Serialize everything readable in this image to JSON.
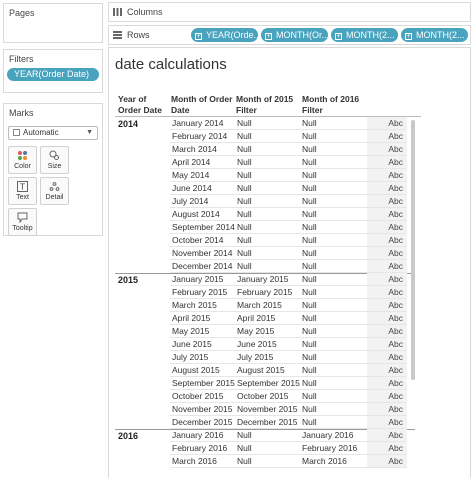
{
  "pages": {
    "title": "Pages"
  },
  "filters": {
    "title": "Filters",
    "items": [
      "YEAR(Order Date)"
    ]
  },
  "marks": {
    "title": "Marks",
    "type": "Automatic",
    "buttons": [
      "Color",
      "Size",
      "Text",
      "Detail",
      "Tooltip"
    ]
  },
  "columns": {
    "label": "Columns"
  },
  "rows": {
    "label": "Rows",
    "pills": [
      "YEAR(Orde...",
      "MONTH(Or...",
      "MONTH(2...",
      "MONTH(2..."
    ]
  },
  "view": {
    "title": "date calculations",
    "headers": {
      "year": [
        "Year of",
        "Order Date"
      ],
      "month": [
        "Month of Order",
        "Date"
      ],
      "f2015": [
        "Month of 2015",
        "Filter"
      ],
      "f2016": [
        "Month of 2016",
        "Filter"
      ]
    },
    "groups": [
      {
        "year": "2014",
        "rows": [
          {
            "month": "January 2014",
            "f2015": "Null",
            "f2016": "Null",
            "abc": "Abc"
          },
          {
            "month": "February 2014",
            "f2015": "Null",
            "f2016": "Null",
            "abc": "Abc"
          },
          {
            "month": "March 2014",
            "f2015": "Null",
            "f2016": "Null",
            "abc": "Abc"
          },
          {
            "month": "April 2014",
            "f2015": "Null",
            "f2016": "Null",
            "abc": "Abc"
          },
          {
            "month": "May 2014",
            "f2015": "Null",
            "f2016": "Null",
            "abc": "Abc"
          },
          {
            "month": "June 2014",
            "f2015": "Null",
            "f2016": "Null",
            "abc": "Abc"
          },
          {
            "month": "July 2014",
            "f2015": "Null",
            "f2016": "Null",
            "abc": "Abc"
          },
          {
            "month": "August 2014",
            "f2015": "Null",
            "f2016": "Null",
            "abc": "Abc"
          },
          {
            "month": "September 2014",
            "f2015": "Null",
            "f2016": "Null",
            "abc": "Abc"
          },
          {
            "month": "October 2014",
            "f2015": "Null",
            "f2016": "Null",
            "abc": "Abc"
          },
          {
            "month": "November 2014",
            "f2015": "Null",
            "f2016": "Null",
            "abc": "Abc"
          },
          {
            "month": "December 2014",
            "f2015": "Null",
            "f2016": "Null",
            "abc": "Abc"
          }
        ]
      },
      {
        "year": "2015",
        "rows": [
          {
            "month": "January 2015",
            "f2015": "January 2015",
            "f2016": "Null",
            "abc": "Abc"
          },
          {
            "month": "February 2015",
            "f2015": "February 2015",
            "f2016": "Null",
            "abc": "Abc"
          },
          {
            "month": "March 2015",
            "f2015": "March 2015",
            "f2016": "Null",
            "abc": "Abc"
          },
          {
            "month": "April 2015",
            "f2015": "April 2015",
            "f2016": "Null",
            "abc": "Abc"
          },
          {
            "month": "May 2015",
            "f2015": "May 2015",
            "f2016": "Null",
            "abc": "Abc"
          },
          {
            "month": "June 2015",
            "f2015": "June 2015",
            "f2016": "Null",
            "abc": "Abc"
          },
          {
            "month": "July 2015",
            "f2015": "July 2015",
            "f2016": "Null",
            "abc": "Abc"
          },
          {
            "month": "August 2015",
            "f2015": "August 2015",
            "f2016": "Null",
            "abc": "Abc"
          },
          {
            "month": "September 2015",
            "f2015": "September 2015",
            "f2016": "Null",
            "abc": "Abc"
          },
          {
            "month": "October 2015",
            "f2015": "October 2015",
            "f2016": "Null",
            "abc": "Abc"
          },
          {
            "month": "November 2015",
            "f2015": "November 2015",
            "f2016": "Null",
            "abc": "Abc"
          },
          {
            "month": "December 2015",
            "f2015": "December 2015",
            "f2016": "Null",
            "abc": "Abc"
          }
        ]
      },
      {
        "year": "2016",
        "rows": [
          {
            "month": "January 2016",
            "f2015": "Null",
            "f2016": "January 2016",
            "abc": "Abc"
          },
          {
            "month": "February 2016",
            "f2015": "Null",
            "f2016": "February 2016",
            "abc": "Abc"
          },
          {
            "month": "March 2016",
            "f2015": "Null",
            "f2016": "March 2016",
            "abc": "Abc"
          }
        ]
      }
    ]
  }
}
